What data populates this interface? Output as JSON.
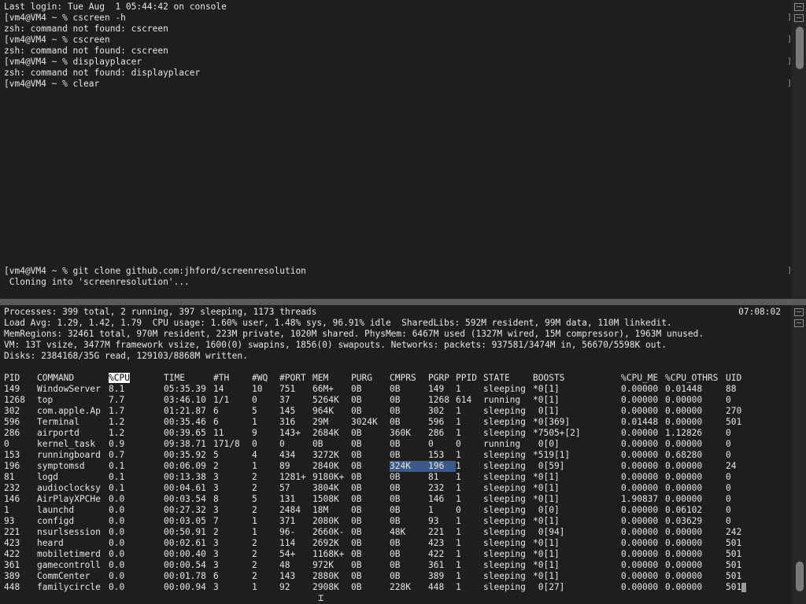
{
  "top_pane": {
    "lines": [
      "Last login: Tue Aug  1 05:44:42 on console",
      "[vm4@VM4 ~ % cscreen -h",
      "zsh: command not found: cscreen",
      "[vm4@VM4 ~ % cscreen",
      "zsh: command not found: cscreen",
      "[vm4@VM4 ~ % displayplacer",
      "zsh: command not found: displayplacer",
      "[vm4@VM4 ~ % clear"
    ],
    "lower_lines": [
      "[vm4@VM4 ~ % git clone github.com:jhford/screenresolution",
      " Cloning into 'screenresolution'..."
    ],
    "right_bracket": "]"
  },
  "bottom_pane": {
    "clock": "07:08:02",
    "summary": [
      "Processes: 399 total, 2 running, 397 sleeping, 1173 threads",
      "Load Avg: 1.29, 1.42, 1.79  CPU usage: 1.60% user, 1.48% sys, 96.91% idle  SharedLibs: 592M resident, 99M data, 110M linkedit.",
      "MemRegions: 32461 total, 970M resident, 223M private, 1020M shared. PhysMem: 6467M used (1327M wired, 15M compressor), 1963M unused.",
      "VM: 13T vsize, 3477M framework vsize, 1600(0) swapins, 1856(0) swapouts. Networks: packets: 937581/3474M in, 56670/5598K out.",
      "Disks: 2384168/35G read, 129103/8868M written."
    ],
    "columns": [
      "PID",
      "COMMAND",
      "%CPU",
      "TIME",
      "#TH",
      "#WQ",
      "#PORT",
      "MEM",
      "PURG",
      "CMPRS",
      "PGRP",
      "PPID",
      "STATE",
      "BOOSTS",
      "%CPU_ME",
      "%CPU_OTHRS",
      "UID"
    ],
    "rows": [
      [
        "149",
        "WindowServer",
        "8.1",
        "05:35.39",
        "14",
        "10",
        "751",
        "66M+",
        "0B",
        "0B",
        "149",
        "1",
        "sleeping",
        "*0[1]",
        "0.00000",
        "0.01448",
        "88"
      ],
      [
        "1268",
        "top",
        "7.7",
        "03:46.10",
        "1/1",
        "0",
        "37",
        "5264K",
        "0B",
        "0B",
        "1268",
        "614",
        "running",
        "*0[1]",
        "0.00000",
        "0.00000",
        "0"
      ],
      [
        "302",
        "com.apple.Ap",
        "1.7",
        "01:21.87",
        "6",
        "5",
        "145",
        "964K",
        "0B",
        "0B",
        "302",
        "1",
        "sleeping",
        " 0[1]",
        "0.00000",
        "0.00000",
        "270"
      ],
      [
        "596",
        "Terminal",
        "1.2",
        "00:35.46",
        "6",
        "1",
        "316",
        "29M",
        "3024K",
        "0B",
        "596",
        "1",
        "sleeping",
        "*0[369]",
        "0.01448",
        "0.00000",
        "501"
      ],
      [
        "286",
        "airportd",
        "1.2",
        "00:39.65",
        "11",
        "9",
        "143+",
        "2684K",
        "0B",
        "360K",
        "286",
        "1",
        "sleeping",
        "*7505+[2]",
        "0.00000",
        "1.12826",
        "0"
      ],
      [
        "0",
        "kernel_task",
        "0.9",
        "09:38.71",
        "171/8",
        "0",
        "0",
        "0B",
        "0B",
        "0B",
        "0",
        "0",
        "running",
        " 0[0]",
        "0.00000",
        "0.00000",
        "0"
      ],
      [
        "153",
        "runningboard",
        "0.7",
        "00:35.92",
        "5",
        "4",
        "434",
        "3272K",
        "0B",
        "0B",
        "153",
        "1",
        "sleeping",
        "*519[1]",
        "0.00000",
        "0.68280",
        "0"
      ],
      [
        "196",
        "symptomsd",
        "0.1",
        "00:06.09",
        "2",
        "1",
        "89",
        "2840K",
        "0B",
        "324K",
        "196",
        "1",
        "sleeping",
        " 0[59]",
        "0.00000",
        "0.00000",
        "24"
      ],
      [
        "81",
        "logd",
        "0.1",
        "00:13.38",
        "3",
        "2",
        "1281+",
        "9180K+",
        "0B",
        "0B",
        "81",
        "1",
        "sleeping",
        "*0[1]",
        "0.00000",
        "0.00000",
        "0"
      ],
      [
        "232",
        "audioclocksy",
        "0.1",
        "00:04.61",
        "3",
        "2",
        "57",
        "3804K",
        "0B",
        "0B",
        "232",
        "1",
        "sleeping",
        "*0[1]",
        "0.00000",
        "0.00000",
        "0"
      ],
      [
        "146",
        "AirPlayXPCHe",
        "0.0",
        "00:03.54",
        "8",
        "5",
        "131",
        "1508K",
        "0B",
        "0B",
        "146",
        "1",
        "sleeping",
        "*0[1]",
        "1.90837",
        "0.00000",
        "0"
      ],
      [
        "1",
        "launchd",
        "0.0",
        "00:27.32",
        "3",
        "2",
        "2484",
        "18M",
        "0B",
        "0B",
        "1",
        "0",
        "sleeping",
        " 0[0]",
        "0.00000",
        "0.06102",
        "0"
      ],
      [
        "93",
        "configd",
        "0.0",
        "00:03.05",
        "7",
        "1",
        "371",
        "2080K",
        "0B",
        "0B",
        "93",
        "1",
        "sleeping",
        "*0[1]",
        "0.00000",
        "0.03629",
        "0"
      ],
      [
        "221",
        "nsurlsession",
        "0.0",
        "00:50.91",
        "2",
        "1",
        "96-",
        "2660K-",
        "0B",
        "48K",
        "221",
        "1",
        "sleeping",
        " 0[94]",
        "0.00000",
        "0.00000",
        "242"
      ],
      [
        "423",
        "heard",
        "0.0",
        "00:02.61",
        "3",
        "2",
        "114",
        "2692K",
        "0B",
        "0B",
        "423",
        "1",
        "sleeping",
        "*0[1]",
        "0.00000",
        "0.00000",
        "501"
      ],
      [
        "422",
        "mobiletimerd",
        "0.0",
        "00:00.40",
        "3",
        "2",
        "54+",
        "1168K+",
        "0B",
        "0B",
        "422",
        "1",
        "sleeping",
        "*0[1]",
        "0.00000",
        "0.00000",
        "501"
      ],
      [
        "361",
        "gamecontroll",
        "0.0",
        "00:00.54",
        "3",
        "2",
        "48",
        "972K",
        "0B",
        "0B",
        "361",
        "1",
        "sleeping",
        "*0[1]",
        "0.00000",
        "0.00000",
        "501"
      ],
      [
        "389",
        "CommCenter",
        "0.0",
        "00:01.78",
        "6",
        "2",
        "143",
        "2880K",
        "0B",
        "0B",
        "389",
        "1",
        "sleeping",
        "*0[1]",
        "0.00000",
        "0.00000",
        "501"
      ],
      [
        "448",
        "familycircle",
        "0.0",
        "00:00.94",
        "3",
        "1",
        "92",
        "2908K",
        "0B",
        "228K",
        "448",
        "1",
        "sleeping",
        " 0[27]",
        "0.00000",
        "0.00000",
        "501"
      ]
    ]
  },
  "colors": {
    "background": "#1e1e1e",
    "text": "#e6e6e6",
    "sort_column_highlight": "#ffffff",
    "selection": "#3a5a8a",
    "divider": "#5a5a5a"
  }
}
